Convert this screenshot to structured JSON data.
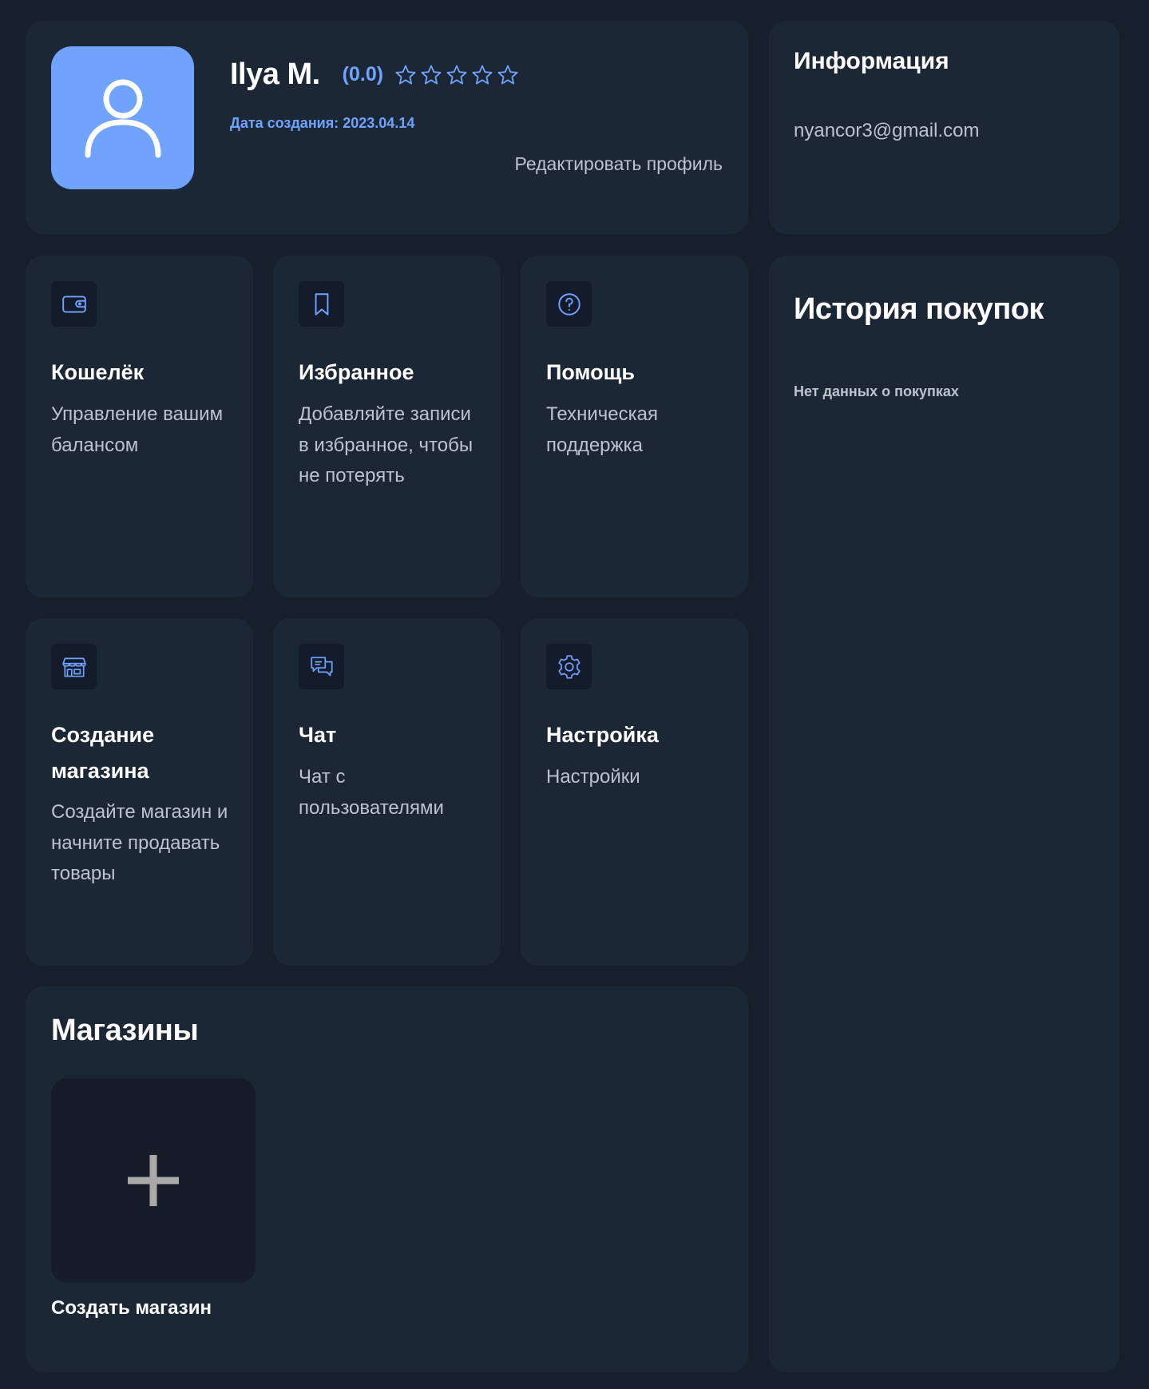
{
  "profile": {
    "name": "Ilya M.",
    "rating_text": "(0.0)",
    "rating": 0.0,
    "rating_max": 5,
    "created_date": "Дата создания: 2023.04.14",
    "edit_label": "Редактировать профиль"
  },
  "info": {
    "title": "Информация",
    "email": "nyancor3@gmail.com"
  },
  "tiles": [
    {
      "icon": "wallet-icon",
      "title": "Кошелёк",
      "desc": "Управление вашим балансом"
    },
    {
      "icon": "bookmark-icon",
      "title": "Избранное",
      "desc": "Добавляйте записи в избранное, чтобы не потерять"
    },
    {
      "icon": "help-icon",
      "title": "Помощь",
      "desc": "Техническая поддержка"
    },
    {
      "icon": "store-icon",
      "title": "Создание магазина",
      "desc": "Создайте магазин и начните продавать товары"
    },
    {
      "icon": "chat-icon",
      "title": "Чат",
      "desc": "Чат с пользователями"
    },
    {
      "icon": "gear-icon",
      "title": "Настройка",
      "desc": "Настройки"
    }
  ],
  "history": {
    "title": "История покупок",
    "empty_text": "Нет данных о покупках"
  },
  "stores": {
    "title": "Магазины",
    "create_label": "Создать магазин"
  },
  "colors": {
    "background": "#161f2a",
    "card": "#1c2736",
    "accent": "#6fa3fd",
    "muted_text": "#bcc3cc",
    "icon_tile": "#141c2c"
  }
}
